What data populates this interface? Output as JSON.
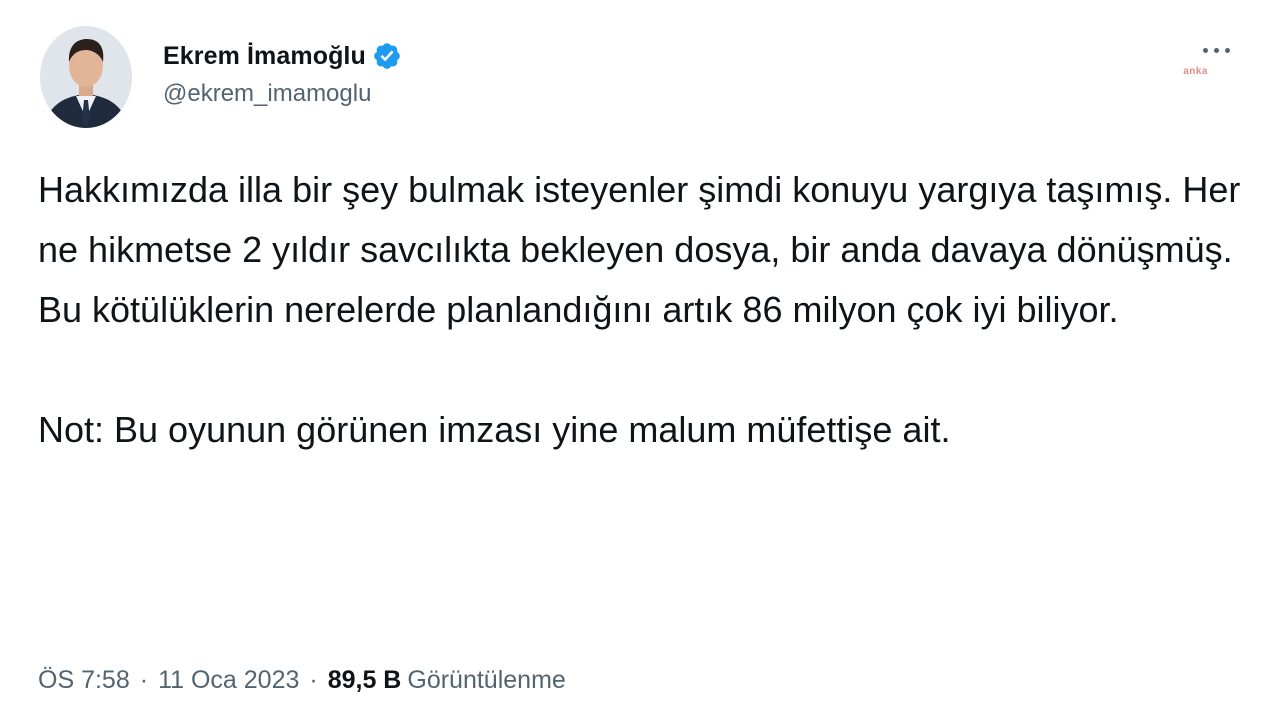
{
  "author": {
    "display_name": "Ekrem İmamoğlu",
    "handle": "@ekrem_imamoglu",
    "verified": true,
    "avatar_icon": "profile-photo"
  },
  "watermark": {
    "text": "anka"
  },
  "tweet": {
    "paragraph_1": "Hakkımızda illa bir şey bulmak isteyenler şimdi konuyu yargıya taşımış. Her ne hikmetse 2 yıldır savcılıkta bekleyen dosya, bir anda davaya dönüşmüş. Bu kötülüklerin nerelerde planlandığını artık 86 milyon çok iyi biliyor.",
    "paragraph_2": "Not: Bu oyunun görünen imzası yine malum müfettişe ait."
  },
  "meta": {
    "time": "ÖS 7:58",
    "separator": "·",
    "date": "11 Oca 2023",
    "views_count": "89,5 B",
    "views_label": "Görüntülenme"
  },
  "colors": {
    "verified": "#1d9bf0",
    "text_primary": "#0f1419",
    "text_secondary": "#536471"
  }
}
